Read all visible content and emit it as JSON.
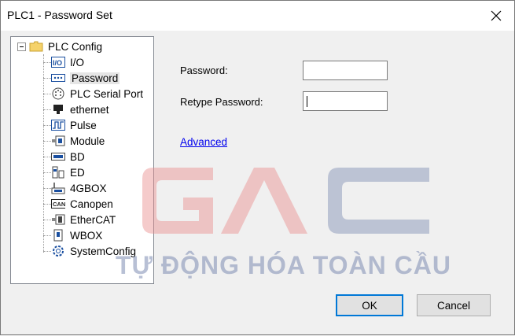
{
  "window": {
    "title": "PLC1 - Password  Set"
  },
  "tree": {
    "root": "PLC Config",
    "items": [
      {
        "label": "I/O",
        "icon": "io-icon"
      },
      {
        "label": "Password",
        "icon": "password-icon"
      },
      {
        "label": "PLC Serial Port",
        "icon": "serial-port-icon"
      },
      {
        "label": "ethernet",
        "icon": "ethernet-icon"
      },
      {
        "label": "Pulse",
        "icon": "pulse-icon"
      },
      {
        "label": "Module",
        "icon": "module-icon"
      },
      {
        "label": "BD",
        "icon": "bd-icon"
      },
      {
        "label": "ED",
        "icon": "ed-icon"
      },
      {
        "label": "4GBOX",
        "icon": "4gbox-icon"
      },
      {
        "label": "Canopen",
        "icon": "canopen-icon"
      },
      {
        "label": "EtherCAT",
        "icon": "ethercat-icon"
      },
      {
        "label": "WBOX",
        "icon": "wbox-icon"
      },
      {
        "label": "SystemConfig",
        "icon": "gear-icon"
      }
    ],
    "selected": "Password"
  },
  "form": {
    "password_label": "Password:",
    "password_value": "",
    "retype_label": "Retype Password:",
    "retype_value": "",
    "advanced_link": "Advanced"
  },
  "buttons": {
    "ok": "OK",
    "cancel": "Cancel"
  },
  "watermark": {
    "logo": "GAC",
    "text": "TỰ ĐỘNG HÓA TOÀN CẦU"
  },
  "colors": {
    "accent": "#0078d7",
    "link": "#0000ee",
    "watermark_red": "#e8a0a0",
    "watermark_blue": "#7d8cb2"
  }
}
